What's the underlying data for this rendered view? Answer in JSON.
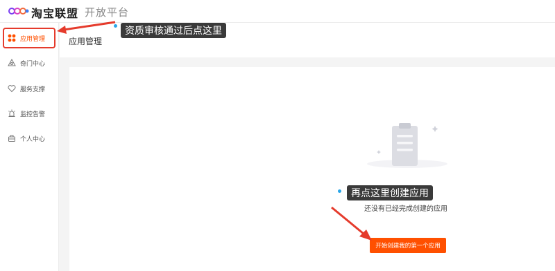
{
  "header": {
    "brand": "淘宝联盟",
    "separator": "·",
    "subtitle": "开放平台"
  },
  "sidebar": {
    "items": [
      {
        "label": "应用管理",
        "icon": "apps-grid-icon",
        "active": true
      },
      {
        "label": "奇门中心",
        "icon": "qimen-icon",
        "active": false
      },
      {
        "label": "服务支撑",
        "icon": "heart-icon",
        "active": false
      },
      {
        "label": "监控告警",
        "icon": "alarm-icon",
        "active": false
      },
      {
        "label": "个人中心",
        "icon": "user-center-icon",
        "active": false
      }
    ]
  },
  "main": {
    "title": "应用管理",
    "empty_text": "还没有已经完成创建的应用",
    "cta_label": "开始创建我的第一个应用"
  },
  "annotations": {
    "tip1": "资质审核通过后点这里",
    "tip2": "再点这里创建应用"
  },
  "colors": {
    "accent": "#ff5000",
    "annotation_red": "#e53b2c",
    "tooltip_bg": "#3a3a3a",
    "dot_blue": "#2aa6e8"
  }
}
